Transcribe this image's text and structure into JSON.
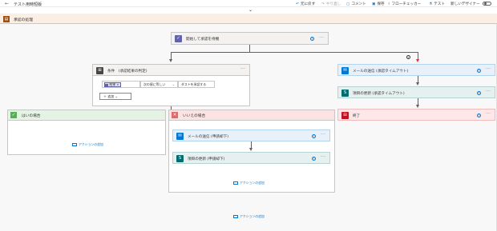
{
  "topbar": {
    "back_glyph": "←",
    "title": "テスト用時短版",
    "undo": "元に戻す",
    "redo": "やり直し",
    "comment": "コメント",
    "save": "保存",
    "flow_checker": "フローチェッカー",
    "test": "テスト",
    "new_designer": "新しいデザイナー"
  },
  "scope": {
    "label": "承認の処理"
  },
  "start_approval": {
    "title": "開始して承認を待機"
  },
  "condition": {
    "title": "条件　(承認結果の判定)",
    "token": "結果",
    "operator": "次の値に等しい",
    "value": "ダストを承認する",
    "add_label": "追加"
  },
  "right_branch": {
    "email": {
      "title": "メールの送信 (承認タイムアウト)"
    },
    "update": {
      "title": "項目の更新 (承認タイムアウト)"
    },
    "terminate": {
      "title": "終了"
    }
  },
  "yes_branch": {
    "title": "はいの場合",
    "add_action": "アクションの追加"
  },
  "no_branch": {
    "title": "いいえの場合",
    "email": {
      "title": "メールの送信 (申請却下)"
    },
    "update": {
      "title": "項目の更新 (申請却下)"
    },
    "add_action": "アクションの追加"
  },
  "bottom_add_action": "アクションの追加",
  "colors": {
    "approvals": "#6264a7",
    "condition": "#484644",
    "outlook": "#0078d4",
    "sharepoint": "#036c70",
    "terminate": "#c50f1f",
    "yes": "#54b054",
    "no": "#e06a6a"
  }
}
